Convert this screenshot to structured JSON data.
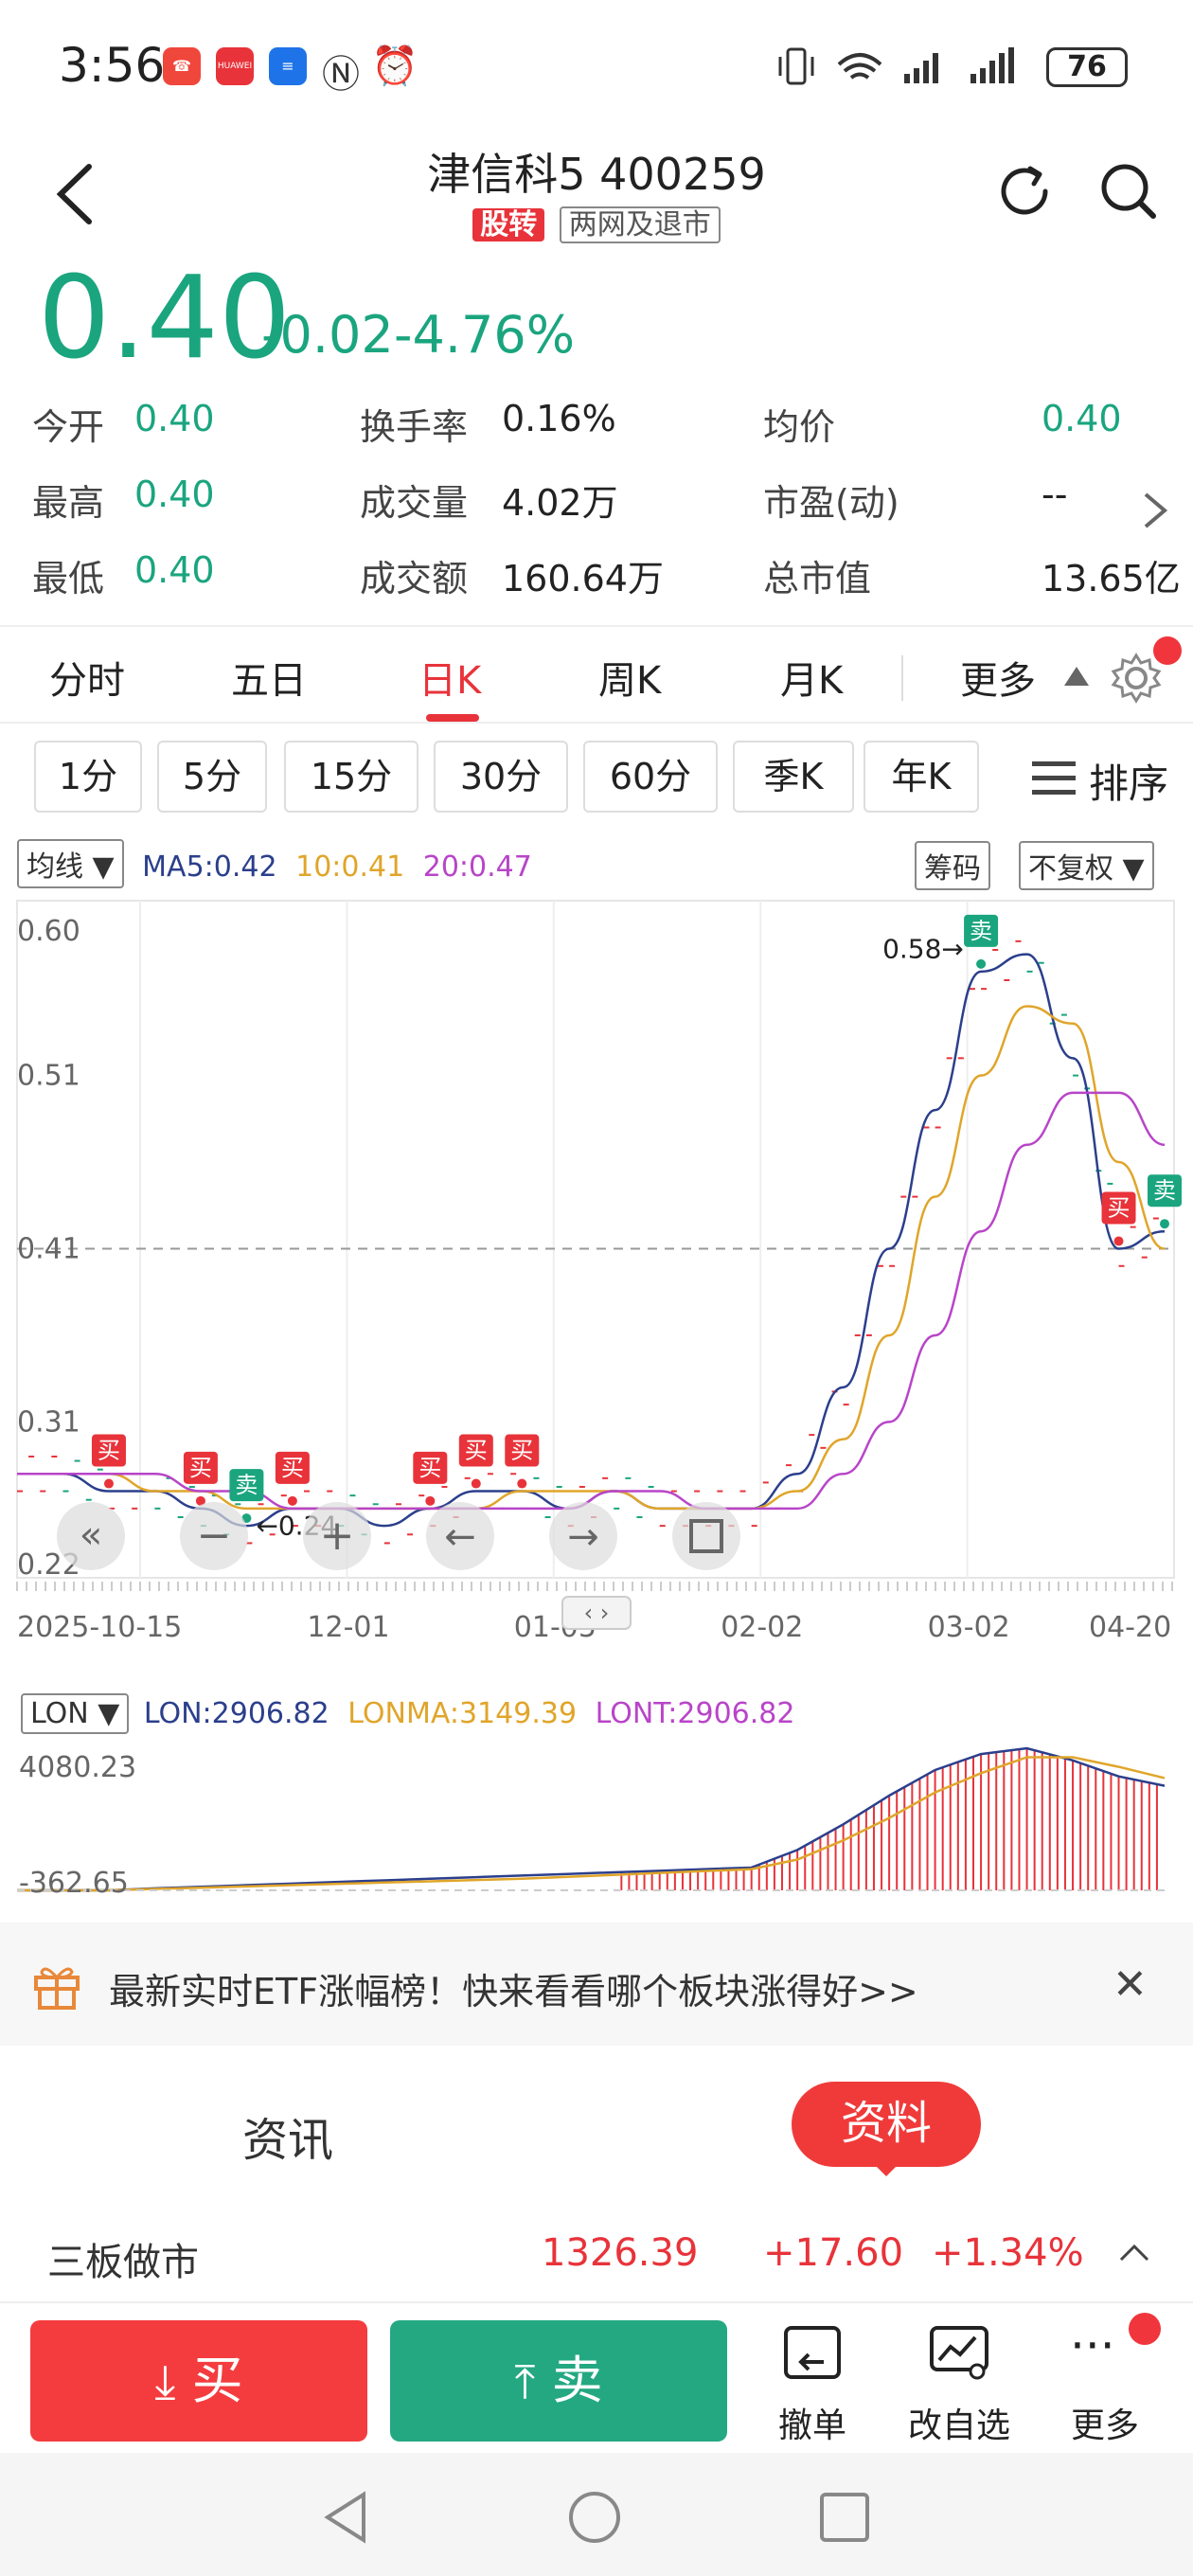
{
  "status": {
    "time": "3:56",
    "battery": "76",
    "app_icons": [
      {
        "icon": "missed-call-icon",
        "color": "#f0473c"
      },
      {
        "icon": "huawei-icon",
        "color": "#e8333a",
        "label": "HUAWEI"
      },
      {
        "icon": "app-blue-icon",
        "color": "#1f73e8"
      },
      {
        "icon": "nfc-icon",
        "color": "#333333"
      },
      {
        "icon": "alarm-icon",
        "color": "#333333"
      }
    ]
  },
  "header": {
    "title": "津信科5 400259",
    "tag_primary": "股转",
    "tag_secondary": "两网及退市"
  },
  "quote": {
    "price": "0.40",
    "change": "-0.02",
    "change_pct": "-4.76%"
  },
  "stats": [
    [
      {
        "label": "今开",
        "value": "0.40",
        "color": "green"
      },
      {
        "label": "换手率",
        "value": "0.16%",
        "color": "dark"
      },
      {
        "label": "均价",
        "value": "0.40",
        "color": "green"
      }
    ],
    [
      {
        "label": "最高",
        "value": "0.40",
        "color": "green"
      },
      {
        "label": "成交量",
        "value": "4.02万",
        "color": "dark"
      },
      {
        "label": "市盈(动)",
        "value": "--",
        "color": "dark"
      }
    ],
    [
      {
        "label": "最低",
        "value": "0.40",
        "color": "green"
      },
      {
        "label": "成交额",
        "value": "160.64万",
        "color": "dark"
      },
      {
        "label": "总市值",
        "value": "13.65亿",
        "color": "dark"
      }
    ]
  ],
  "tabs": [
    "分时",
    "五日",
    "日K",
    "周K",
    "月K",
    "更多"
  ],
  "active_tab": "日K",
  "sub_periods": [
    "1分",
    "5分",
    "15分",
    "30分",
    "60分",
    "季K",
    "年K"
  ],
  "sort_label": "排序",
  "chart": {
    "indicator": "均线",
    "ma5": "MA5:0.42",
    "ma10": "10:0.41",
    "ma20": "20:0.47",
    "chip_btn": "筹码",
    "adjust_btn": "不复权",
    "colors": {
      "ma5": "#2b3f8c",
      "ma10": "#e0a52a",
      "ma20": "#b845c8",
      "up": "#e8333a",
      "down": "#1aa57f"
    },
    "buy_label": "买",
    "sell_label": "卖",
    "peak_label": "0.58→",
    "low_label": "←0.24"
  },
  "chart_data": {
    "type": "line",
    "x_ticks": [
      "2025-10-15",
      "12-01",
      "01-05",
      "02-02",
      "03-02",
      "04-20"
    ],
    "y_ticks": [
      "0.60",
      "0.51",
      "0.41",
      "0.31",
      "0.22"
    ],
    "ylim": [
      0.22,
      0.6
    ],
    "series": [
      {
        "name": "MA5",
        "values": [
          0.28,
          0.28,
          0.27,
          0.27,
          0.26,
          0.25,
          0.26,
          0.26,
          0.25,
          0.26,
          0.27,
          0.27,
          0.26,
          0.27,
          0.26,
          0.26,
          0.26,
          0.28,
          0.33,
          0.41,
          0.49,
          0.57,
          0.58,
          0.52,
          0.41,
          0.42
        ]
      },
      {
        "name": "10",
        "values": [
          0.28,
          0.28,
          0.28,
          0.27,
          0.27,
          0.26,
          0.26,
          0.26,
          0.26,
          0.26,
          0.26,
          0.27,
          0.27,
          0.27,
          0.26,
          0.26,
          0.26,
          0.27,
          0.3,
          0.36,
          0.44,
          0.51,
          0.55,
          0.54,
          0.46,
          0.41
        ]
      },
      {
        "name": "20",
        "values": [
          0.28,
          0.28,
          0.28,
          0.28,
          0.27,
          0.27,
          0.26,
          0.26,
          0.26,
          0.26,
          0.26,
          0.26,
          0.26,
          0.27,
          0.27,
          0.26,
          0.26,
          0.26,
          0.28,
          0.31,
          0.36,
          0.42,
          0.47,
          0.5,
          0.5,
          0.47
        ]
      }
    ],
    "sub_chart": {
      "indicator": "LON",
      "lon": "LON:2906.82",
      "lonma": "LONMA:3149.39",
      "lont": "LONT:2906.82",
      "y_max": "4080.23",
      "y_min": "-362.65",
      "ylim": [
        -362.65,
        4080.23
      ],
      "lon_values": [
        -362,
        -362,
        -362,
        -300,
        -250,
        -200,
        -150,
        -100,
        -50,
        0,
        50,
        100,
        150,
        200,
        250,
        300,
        350,
        900,
        1700,
        2600,
        3400,
        3900,
        4080,
        3700,
        3200,
        2906
      ],
      "lonma_values": [
        -362,
        -362,
        -362,
        -320,
        -280,
        -240,
        -200,
        -160,
        -120,
        -80,
        -40,
        0,
        60,
        120,
        180,
        240,
        300,
        600,
        1200,
        1900,
        2700,
        3300,
        3800,
        3800,
        3500,
        3149
      ]
    }
  },
  "banner": {
    "text": "最新实时ETF涨幅榜！快来看看哪个板块涨得好>>"
  },
  "info_tabs": {
    "news": "资讯",
    "profile": "资料"
  },
  "market": {
    "name": "三板做市",
    "value": "1326.39",
    "change": "+17.60",
    "pct": "+1.34%"
  },
  "actions": {
    "buy": "买",
    "sell": "卖",
    "cancel": "撤单",
    "edit_watch": "改自选",
    "more": "更多"
  }
}
